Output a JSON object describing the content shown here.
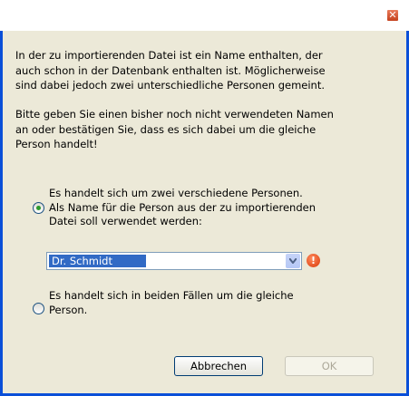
{
  "titlebar": {
    "close_glyph": "✕"
  },
  "intro": {
    "paragraph1": "In der zu importierenden Datei ist ein Name enthalten, der\nauch schon in der Datenbank enthalten ist. Möglicherweise\nsind dabei jedoch zwei unterschiedliche Personen gemeint.",
    "paragraph2": "Bitte geben Sie einen bisher noch nicht verwendeten Namen\nan oder bestätigen Sie, dass es sich dabei um die gleiche\nPerson handelt!"
  },
  "options": {
    "different": {
      "label": "Es handelt sich um zwei verschiedene Personen.\nAls Name für die Person aus der zu importierenden\nDatei soll verwendet werden:",
      "selected": true
    },
    "same": {
      "label": "Es handelt sich in beiden Fällen um die gleiche\nPerson.",
      "selected": false
    }
  },
  "name_combo": {
    "value": "Dr. Schmidt"
  },
  "warning": {
    "icon": "warning-icon",
    "glyph": "!"
  },
  "buttons": {
    "cancel": "Abbrechen",
    "ok": "OK"
  },
  "colors": {
    "frame": "#0a4fd8",
    "dialog_bg": "#ece9d8",
    "selection": "#316ac5"
  }
}
